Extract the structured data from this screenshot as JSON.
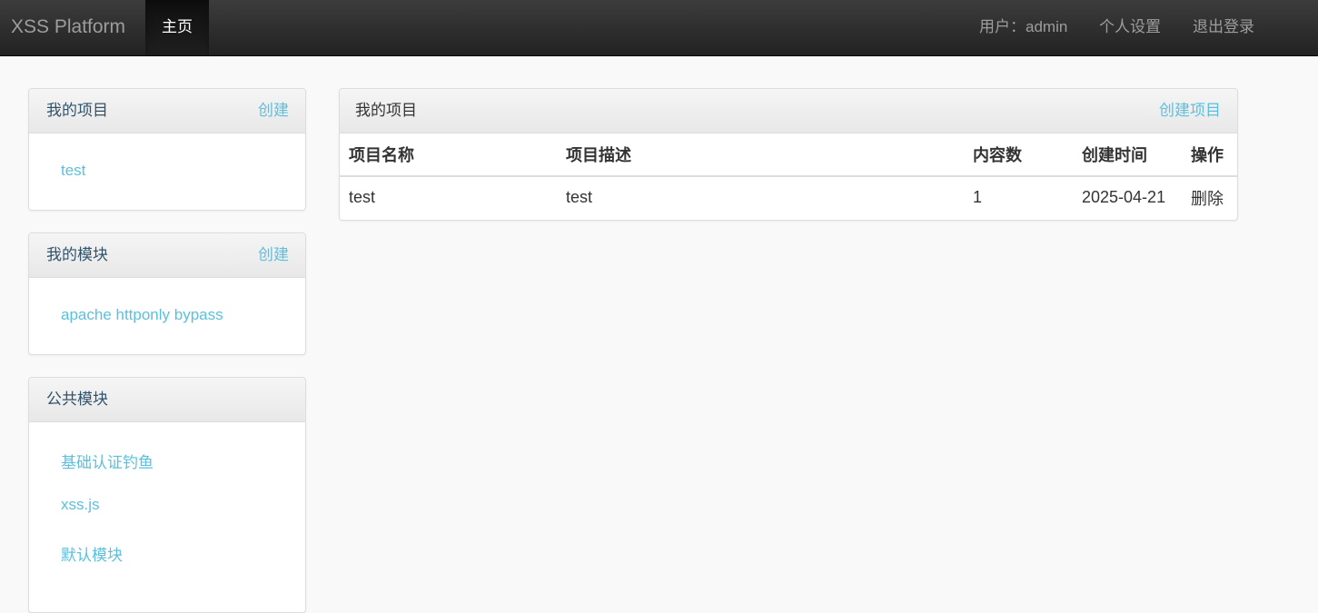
{
  "navbar": {
    "brand": "XSS Platform",
    "home": "主页",
    "user": "用户：admin",
    "settings": "个人设置",
    "logout": "退出登录"
  },
  "sidebar": {
    "projects": {
      "title": "我的项目",
      "action": "创建",
      "items": [
        "test"
      ]
    },
    "modules": {
      "title": "我的模块",
      "action": "创建",
      "items": [
        "apache httponly bypass"
      ]
    },
    "public_modules": {
      "title": "公共模块",
      "items": [
        "基础认证钓鱼",
        "xss.js",
        "默认模块"
      ]
    }
  },
  "main": {
    "title": "我的项目",
    "action": "创建项目",
    "columns": [
      "项目名称",
      "项目描述",
      "内容数",
      "创建时间",
      "操作"
    ],
    "rows": [
      {
        "name": "test",
        "description": "test",
        "count": "1",
        "created": "2025-04-21",
        "op": "删除"
      }
    ]
  },
  "colors": {
    "navbar": "#222222",
    "link": "#5bc0de",
    "background": "#f9f9f9"
  }
}
